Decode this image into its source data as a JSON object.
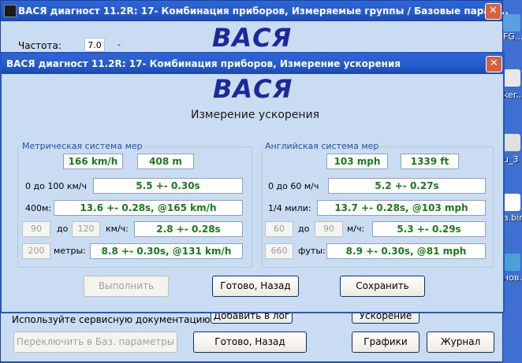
{
  "desktop": {
    "labels": [
      "FG...",
      "ker...",
      "u_3",
      "a.bin",
      "нов."
    ]
  },
  "back_window": {
    "title": "ВАСЯ диагност 11.2R: 17- Комбинация приборов,  Измеряемые группы / Базовые парам...",
    "close": "✕",
    "freq_label": "Частота:",
    "freq_value": "7.0",
    "dash": "-",
    "logo": "ВАСЯ",
    "service_doc": "Используйте сервисную документацию!",
    "add_log_button": "Добавить в лог",
    "accel_button": "Ускорение",
    "switch_button": "Переключить в Баз. параметры",
    "done_back_button": "Готово, Назад",
    "graphs_button": "Графики",
    "journal_button": "Журнал"
  },
  "front_window": {
    "title": "ВАСЯ диагност 11.2R: 17- Комбинация приборов,  Измерение ускорения",
    "close": "✕",
    "logo": "ВАСЯ",
    "subtitle": "Измерение ускорения",
    "metric": {
      "legend": "Метрическая система мер",
      "speed": "166 km/h",
      "distance": "408 m",
      "row1_label": "0 до 100 км/ч",
      "row1_value": "5.5 +- 0.30s",
      "row2_label": "400м:",
      "row2_value": "13.6 +- 0.28s, @165 km/h",
      "row3_from": "90",
      "row3_mid": "до",
      "row3_to": "120",
      "row3_unit": "км/ч:",
      "row3_value": "2.8 +- 0.28s",
      "row4_in": "200",
      "row4_unit": "метры:",
      "row4_value": "8.8 +- 0.30s, @131 km/h"
    },
    "imperial": {
      "legend": "Английская система мер",
      "speed": "103 mph",
      "distance": "1339 ft",
      "row1_label": "0 до 60 м/ч",
      "row1_value": "5.2 +- 0.27s",
      "row2_label": "1/4 мили:",
      "row2_value": "13.7 +- 0.28s, @103 mph",
      "row3_from": "60",
      "row3_mid": "до",
      "row3_to": "90",
      "row3_unit": "м/ч:",
      "row3_value": "5.3 +- 0.29s",
      "row4_in": "660",
      "row4_unit": "футы:",
      "row4_value": "8.9 +- 0.30s, @81 mph"
    },
    "run_button": "Выполнить",
    "done_back_button": "Готово, Назад",
    "save_button": "Сохранить"
  }
}
